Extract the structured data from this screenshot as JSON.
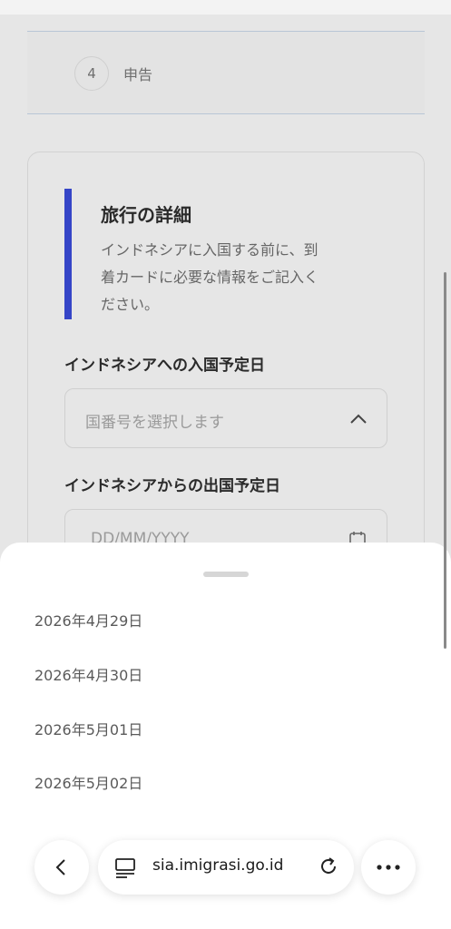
{
  "steps": {
    "current_number": "4",
    "current_label": "申告"
  },
  "travel_card": {
    "title": "旅行の詳細",
    "description_lines": [
      "インドネシアに入国する前に、到",
      "着カードに必要な情報をご記入く",
      "ださい。"
    ]
  },
  "arrival_date": {
    "label": "インドネシアへの入国予定日",
    "placeholder": "国番号を選択します",
    "expanded": true
  },
  "departure_date": {
    "label": "インドネシアからの出国予定日",
    "placeholder": "DD/MM/YYYY"
  },
  "date_options": [
    "2026年4月29日",
    "2026年4月30日",
    "2026年5月01日",
    "2026年5月02日"
  ],
  "browser": {
    "url": "sia.imigrasi.go.id",
    "back_icon": "chevron-left-icon",
    "tab_icon": "page-icon",
    "reload_icon": "reload-icon",
    "more_icon": "more-horizontal-icon"
  },
  "colors": {
    "accent": "#3545c7",
    "sheet": "#ffffff",
    "overlay": "#e6e6e6"
  }
}
